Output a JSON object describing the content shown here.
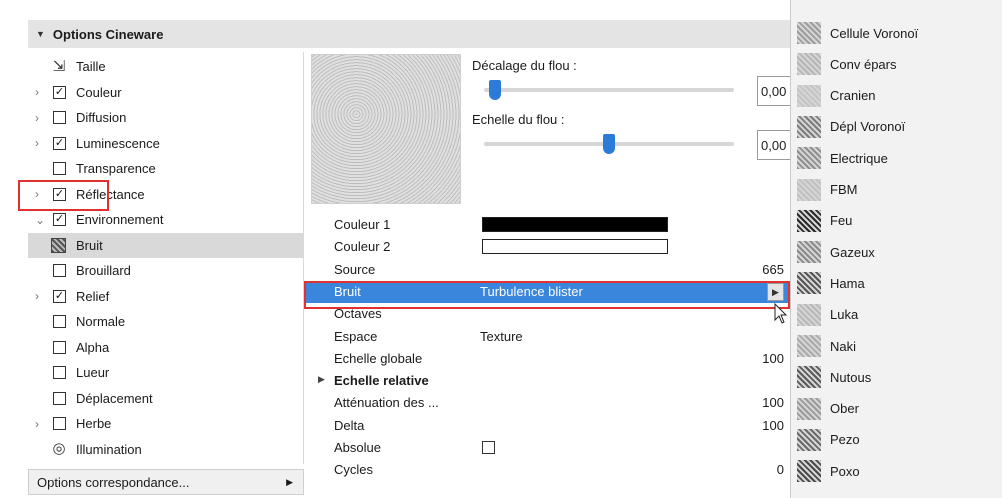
{
  "section": {
    "title": "Options Cineware"
  },
  "tree": {
    "items": [
      {
        "label": "Taille",
        "expandable": false,
        "control": "icon",
        "icon": "resize-icon",
        "checked": false
      },
      {
        "label": "Couleur",
        "expandable": true,
        "control": "checkbox",
        "checked": true
      },
      {
        "label": "Diffusion",
        "expandable": true,
        "control": "checkbox",
        "checked": false
      },
      {
        "label": "Luminescence",
        "expandable": true,
        "control": "checkbox",
        "checked": true
      },
      {
        "label": "Transparence",
        "expandable": false,
        "control": "checkbox",
        "checked": false
      },
      {
        "label": "Réflectance",
        "expandable": true,
        "control": "checkbox",
        "checked": true
      },
      {
        "label": "Environnement",
        "expandable": true,
        "expanded": true,
        "control": "checkbox",
        "checked": true
      },
      {
        "label": "Bruit",
        "expandable": false,
        "control": "noise-icon",
        "selected": true
      },
      {
        "label": "Brouillard",
        "expandable": false,
        "control": "checkbox",
        "checked": false
      },
      {
        "label": "Relief",
        "expandable": true,
        "control": "checkbox",
        "checked": true
      },
      {
        "label": "Normale",
        "expandable": false,
        "control": "checkbox",
        "checked": false
      },
      {
        "label": "Alpha",
        "expandable": false,
        "control": "checkbox",
        "checked": false
      },
      {
        "label": "Lueur",
        "expandable": false,
        "control": "checkbox",
        "checked": false
      },
      {
        "label": "Déplacement",
        "expandable": false,
        "control": "checkbox",
        "checked": false
      },
      {
        "label": "Herbe",
        "expandable": true,
        "control": "checkbox",
        "checked": false
      },
      {
        "label": "Illumination",
        "expandable": false,
        "control": "icon",
        "icon": "illumination-icon"
      }
    ]
  },
  "options_select": {
    "label": "Options correspondance..."
  },
  "sliders": {
    "blur_offset": {
      "label": "Décalage du flou :",
      "value": "0,00",
      "level": 0.02
    },
    "blur_scale": {
      "label": "Echelle du flou :",
      "value": "0,00",
      "level": 0.5
    }
  },
  "params": [
    {
      "key": "Couleur 1",
      "type": "swatch",
      "color": "#000000"
    },
    {
      "key": "Couleur 2",
      "type": "swatch",
      "color": "#ffffff"
    },
    {
      "key": "Source",
      "type": "number",
      "num": "665"
    },
    {
      "key": "Bruit",
      "type": "dropdown",
      "val": "Turbulence blister",
      "selected": true
    },
    {
      "key": "Octaves",
      "type": "text"
    },
    {
      "key": "Espace",
      "type": "text",
      "val": "Texture"
    },
    {
      "key": "Echelle globale",
      "type": "number",
      "num": "100"
    },
    {
      "key": "Echelle relative",
      "type": "group"
    },
    {
      "key": "Atténuation des ...",
      "type": "number",
      "num": "100"
    },
    {
      "key": "Delta",
      "type": "number",
      "num": "100"
    },
    {
      "key": "Absolue",
      "type": "checkbox"
    },
    {
      "key": "Cycles",
      "type": "number",
      "num": "0"
    }
  ],
  "noise_menu": {
    "items": [
      {
        "label": "Cellule Voronoï",
        "shade": "#9d9d9d"
      },
      {
        "label": "Conv épars",
        "shade": "#b5b5b5"
      },
      {
        "label": "Cranien",
        "shade": "#c4c4c4"
      },
      {
        "label": "Dépl Voronoï",
        "shade": "#7d7d7d"
      },
      {
        "label": "Electrique",
        "shade": "#8f8f8f"
      },
      {
        "label": "FBM",
        "shade": "#c0c0c0"
      },
      {
        "label": "Feu",
        "shade": "#2a2a2a"
      },
      {
        "label": "Gazeux",
        "shade": "#8a8a8a"
      },
      {
        "label": "Hama",
        "shade": "#555555"
      },
      {
        "label": "Luka",
        "shade": "#b8b8b8"
      },
      {
        "label": "Naki",
        "shade": "#aaaaaa"
      },
      {
        "label": "Nutous",
        "shade": "#5a5a5a"
      },
      {
        "label": "Ober",
        "shade": "#9a9a9a"
      },
      {
        "label": "Pezo",
        "shade": "#6a6a6a"
      },
      {
        "label": "Poxo",
        "shade": "#4a4a4a"
      }
    ]
  }
}
